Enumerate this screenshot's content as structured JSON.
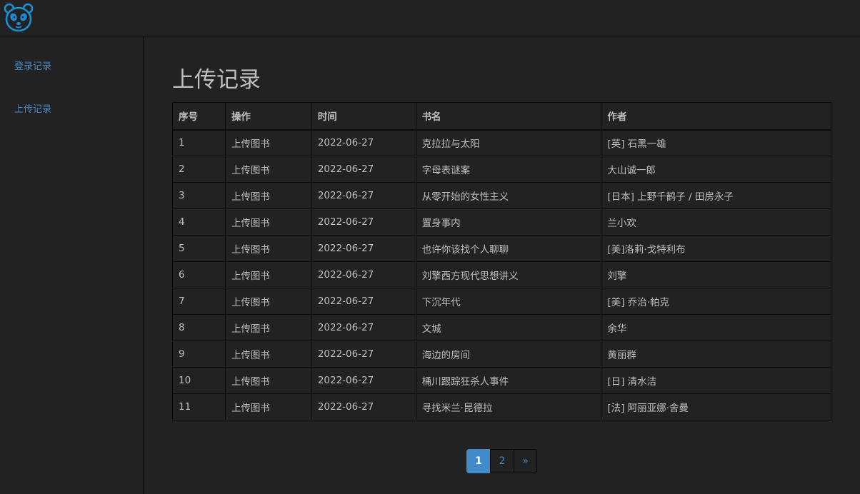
{
  "colors": {
    "background": "#222222",
    "accent": "#428bca",
    "text": "#bfbfbf",
    "border": "#080808"
  },
  "topbar": {
    "logo_icon": "panda-logo-icon"
  },
  "sidebar": {
    "items": [
      {
        "label": "登录记录"
      },
      {
        "label": "上传记录"
      }
    ]
  },
  "main": {
    "title": "上传记录",
    "table": {
      "headers": [
        "序号",
        "操作",
        "时间",
        "书名",
        "作者"
      ],
      "rows": [
        [
          "1",
          "上传图书",
          "2022-06-27",
          "克拉拉与太阳",
          "[英] 石黑一雄"
        ],
        [
          "2",
          "上传图书",
          "2022-06-27",
          "字母表谜案",
          "大山诚一郎"
        ],
        [
          "3",
          "上传图书",
          "2022-06-27",
          "从零开始的女性主义",
          "[日本] 上野千鹤子 / 田房永子"
        ],
        [
          "4",
          "上传图书",
          "2022-06-27",
          "置身事内",
          "兰小欢"
        ],
        [
          "5",
          "上传图书",
          "2022-06-27",
          "也许你该找个人聊聊",
          "[美]洛莉·戈特利布"
        ],
        [
          "6",
          "上传图书",
          "2022-06-27",
          "刘擎西方现代思想讲义",
          "刘擎"
        ],
        [
          "7",
          "上传图书",
          "2022-06-27",
          "下沉年代",
          "[美] 乔治·帕克"
        ],
        [
          "8",
          "上传图书",
          "2022-06-27",
          "文城",
          "余华"
        ],
        [
          "9",
          "上传图书",
          "2022-06-27",
          "海边的房间",
          "黄丽群"
        ],
        [
          "10",
          "上传图书",
          "2022-06-27",
          "桶川跟踪狂杀人事件",
          "[日] 清水洁"
        ],
        [
          "11",
          "上传图书",
          "2022-06-27",
          "寻找米兰·昆德拉",
          "[法] 阿丽亚娜·舍曼"
        ]
      ]
    },
    "pagination": {
      "pages": [
        "1",
        "2"
      ],
      "current": "1",
      "next_label": "»"
    }
  }
}
